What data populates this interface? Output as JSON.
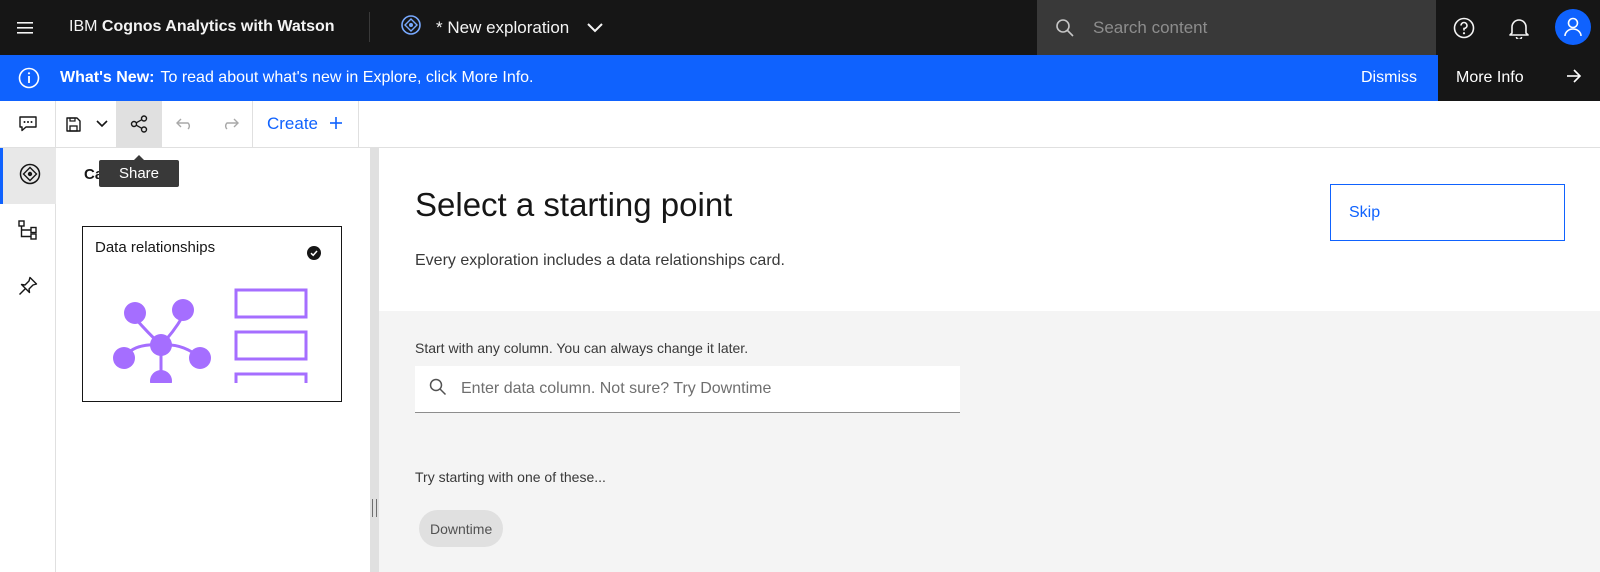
{
  "header": {
    "brand_prefix": "IBM",
    "brand_bold": "Cognos Analytics with Watson",
    "exploration_title": "* New exploration",
    "search_placeholder": "Search content"
  },
  "notification": {
    "heading": "What's New:",
    "message": "To read about what's new in Explore, click More Info.",
    "dismiss_label": "Dismiss",
    "more_info_label": "More Info"
  },
  "toolbar": {
    "create_label": "Create",
    "tooltip": "Share"
  },
  "side_panel": {
    "heading": "Ca",
    "card_title": "Data relationships"
  },
  "main": {
    "title": "Select a starting point",
    "subtitle": "Every exploration includes a data relationships card.",
    "skip_label": "Skip",
    "column_prompt": "Start with any column. You can always change it later.",
    "column_placeholder": "Enter data column. Not sure? Try Downtime",
    "suggestions_prompt": "Try starting with one of these...",
    "suggestions": [
      "Downtime"
    ]
  },
  "colors": {
    "accent": "#0f62fe",
    "header_bg": "#161616",
    "illustration": "#a56eff"
  }
}
